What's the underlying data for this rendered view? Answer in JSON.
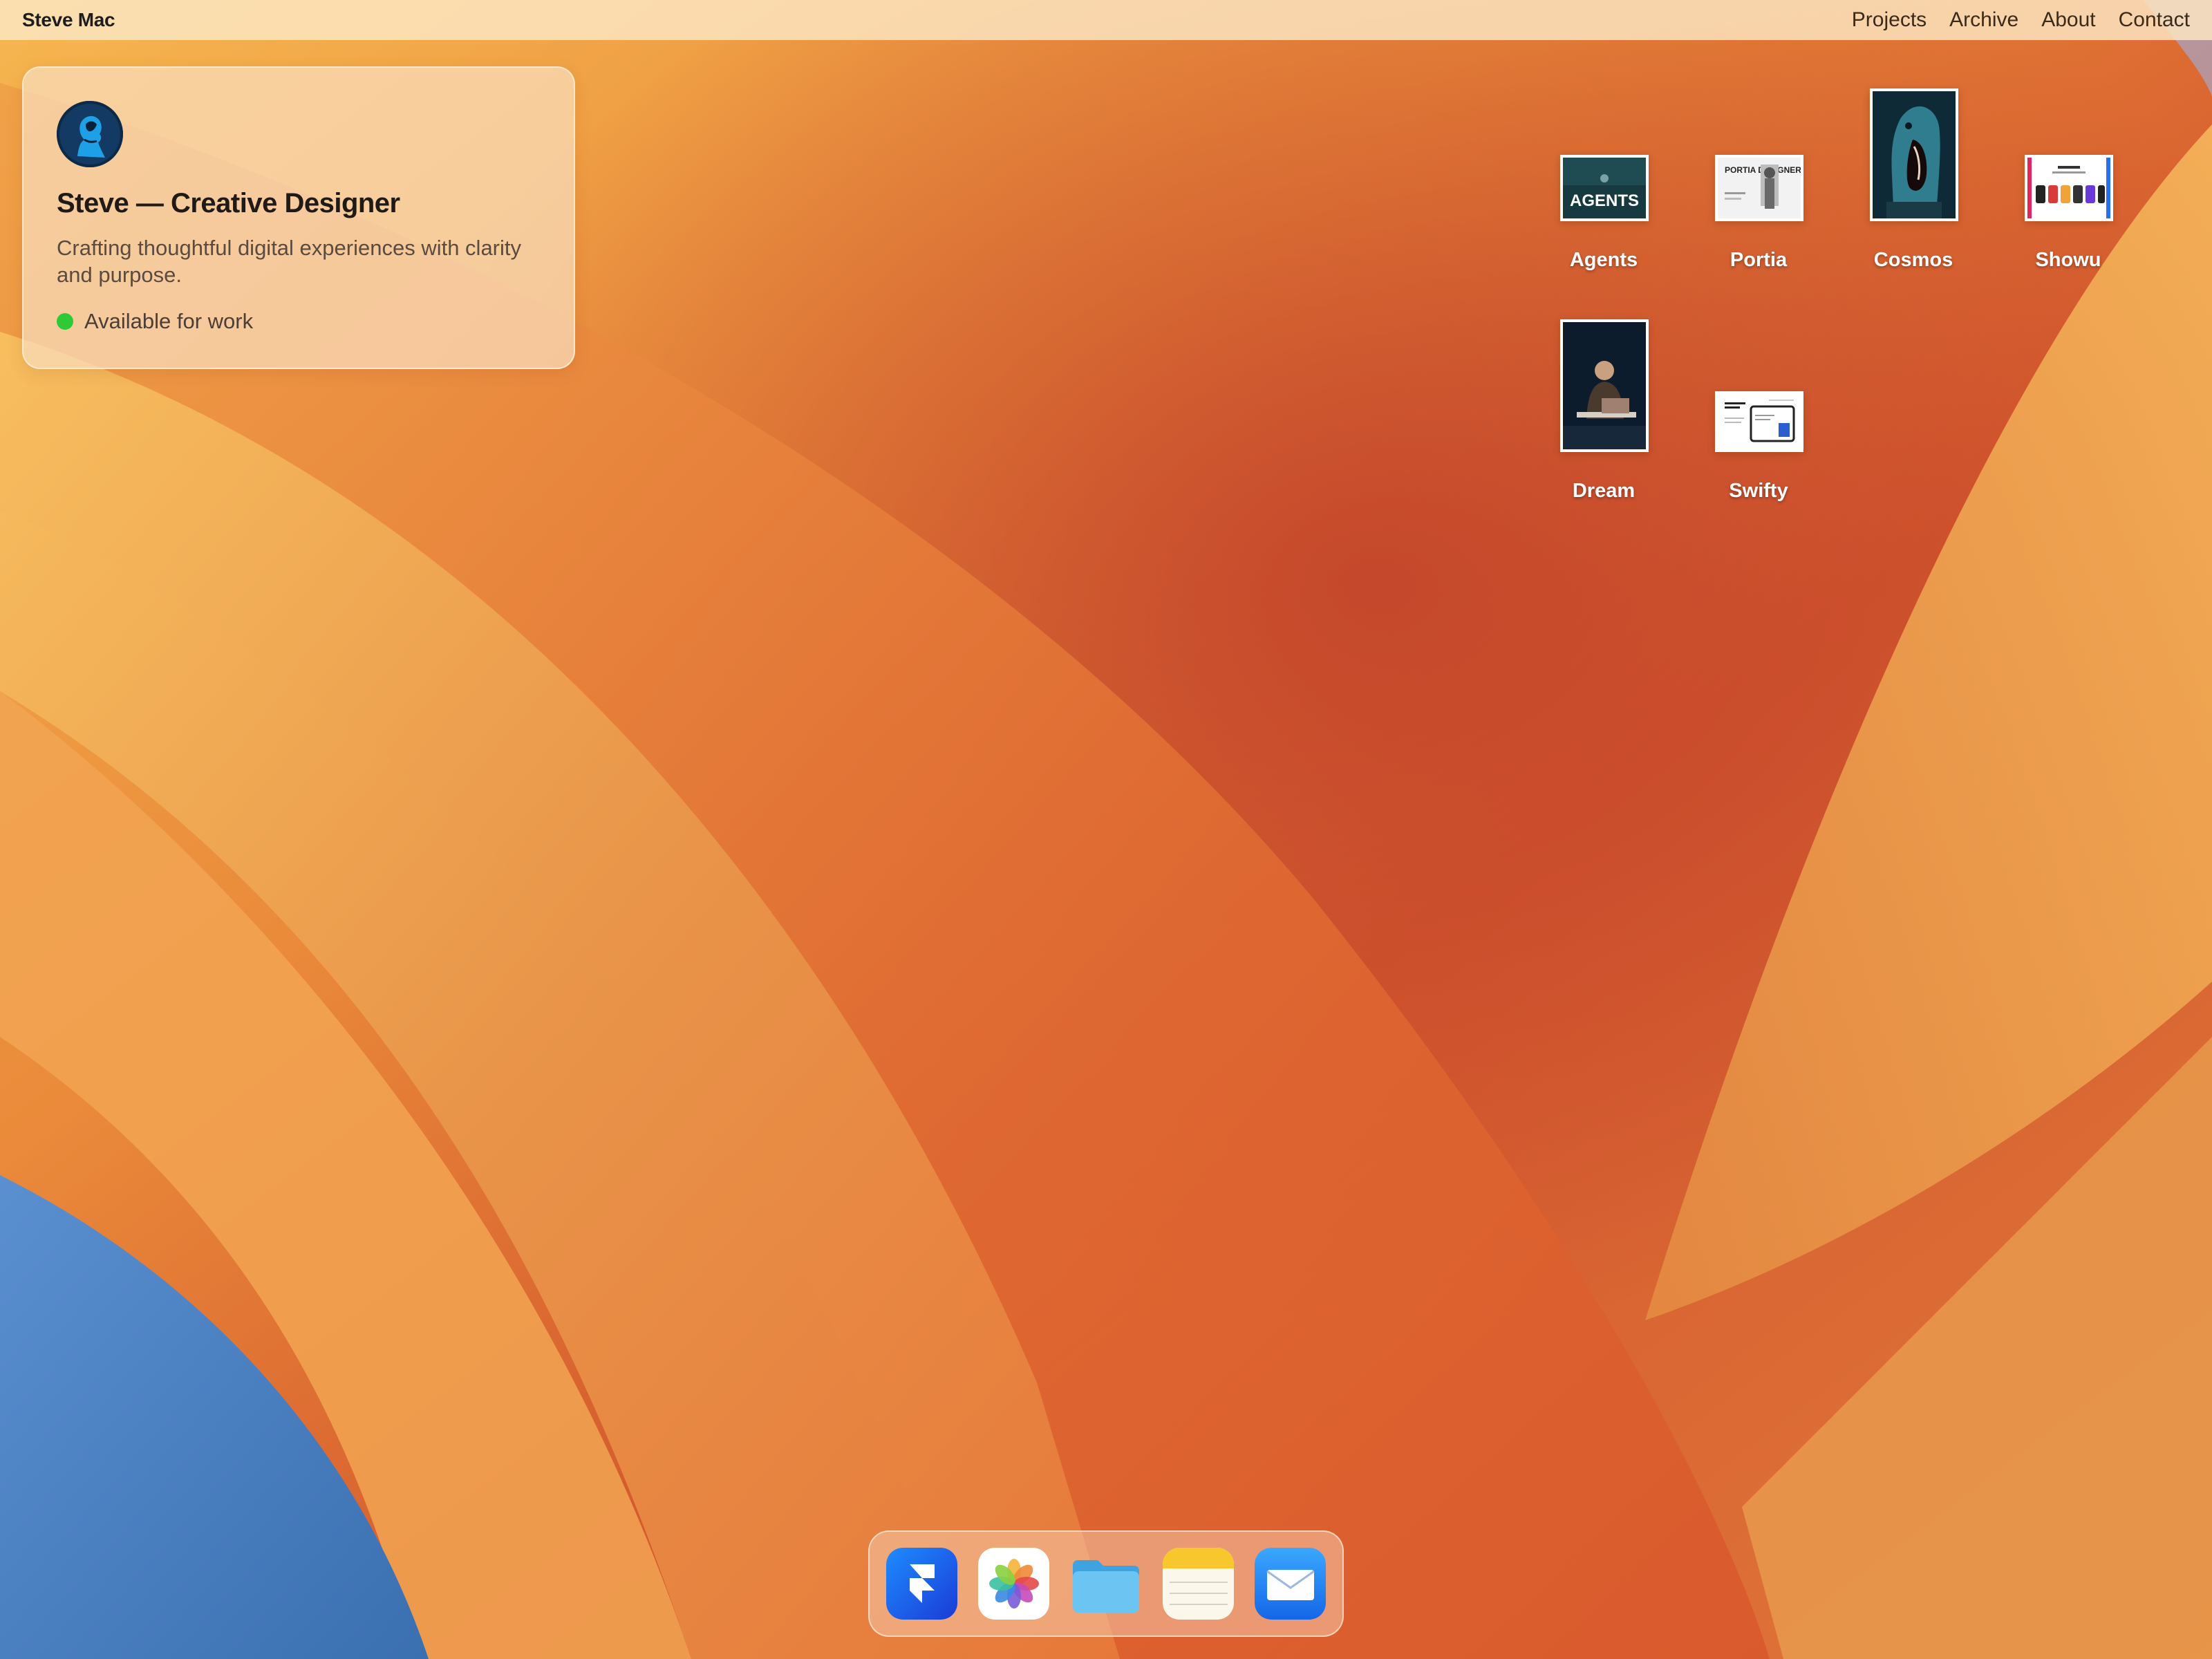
{
  "menubar": {
    "brand": "Steve Mac",
    "nav": [
      "Projects",
      "Archive",
      "About",
      "Contact"
    ]
  },
  "profile": {
    "avatar_icon": "profile-avatar",
    "title": "Steve — Creative Designer",
    "description": "Crafting thoughtful digital experiences with clarity and purpose.",
    "status": "Available for work",
    "status_color": "#2dc937"
  },
  "desktop": {
    "items": [
      {
        "label": "Agents",
        "thumb_text": "AGENTS"
      },
      {
        "label": "Portia",
        "thumb_text": "PORTIA DESIGNER"
      },
      {
        "label": "Cosmos"
      },
      {
        "label": "Showu"
      },
      {
        "label": "Dream"
      },
      {
        "label": "Swifty"
      }
    ]
  },
  "dock": {
    "apps": [
      {
        "name": "Framer",
        "icon": "framer-icon"
      },
      {
        "name": "Photos",
        "icon": "photos-icon"
      },
      {
        "name": "Files",
        "icon": "folder-icon"
      },
      {
        "name": "Notes",
        "icon": "notes-icon"
      },
      {
        "name": "Mail",
        "icon": "mail-icon"
      }
    ]
  },
  "colors": {
    "wallpaper_orange": "#e8873a",
    "wallpaper_deep": "#c8462a",
    "wallpaper_blue": "#4a7fc0",
    "accent_green": "#2dc937"
  }
}
